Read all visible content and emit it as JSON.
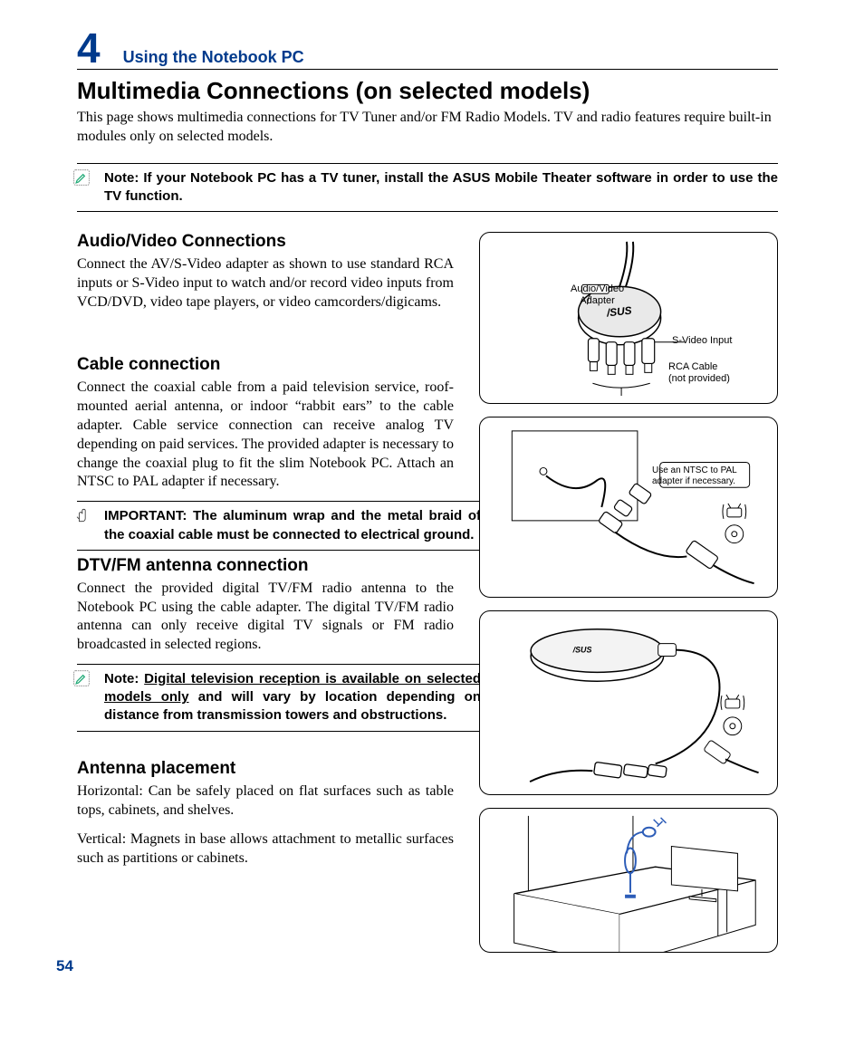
{
  "chapter": {
    "number": "4",
    "title": "Using the Notebook PC"
  },
  "page_number": "54",
  "main_heading": "Multimedia Connections (on selected models)",
  "intro": "This page shows multimedia connections for TV Tuner and/or FM Radio Models. TV and radio features require built-in modules only on selected models.",
  "top_note": "Note: If your Notebook PC has a TV tuner, install the ASUS Mobile Theater software in order to use the TV function.",
  "sections": {
    "av": {
      "heading": "Audio/Video Connections",
      "body": "Connect the AV/S-Video adapter as shown to use standard RCA inputs or S-Video input to watch and/or record video inputs from VCD/DVD, video tape players, or video camcorders/digicams."
    },
    "cable": {
      "heading": "Cable connection",
      "body": "Connect the coaxial cable from a paid television service, roof-mounted aerial antenna, or indoor “rabbit ears” to the cable adapter. Cable service connection can receive analog TV depending on paid services. The provided adapter is necessary to change the coaxial plug to fit the slim Notebook PC. Attach an NTSC to PAL adapter if necessary."
    },
    "cable_important": "IMPORTANT: The aluminum wrap and the metal braid of the coaxial cable must be connected to electrical ground.",
    "dtv": {
      "heading": "DTV/FM antenna connection",
      "body": "Connect the provided digital TV/FM radio antenna to the Notebook PC using the cable adapter. The digital TV/FM radio antenna can only receive digital TV signals or FM radio broadcasted in selected regions."
    },
    "dtv_note_pre": "Note: ",
    "dtv_note_underline": "Digital television reception is available on selected models only",
    "dtv_note_post": " and will vary by location depending on distance from transmission towers and obstructions.",
    "antenna": {
      "heading": "Antenna placement",
      "body1": "Horizontal: Can be safely placed on flat surfaces such as table tops, cabinets, and shelves.",
      "body2": "Vertical: Magnets in base allows attachment to metallic surfaces such as partitions or cabinets."
    }
  },
  "diagram1": {
    "adapter_label": "Audio/Video\nAdapter",
    "svideo_label": "S-Video Input",
    "rca_label": "RCA Cable\n(not provided)"
  },
  "diagram2": {
    "ntsc_label": "Use an NTSC to PAL\nadapter if necessary."
  }
}
